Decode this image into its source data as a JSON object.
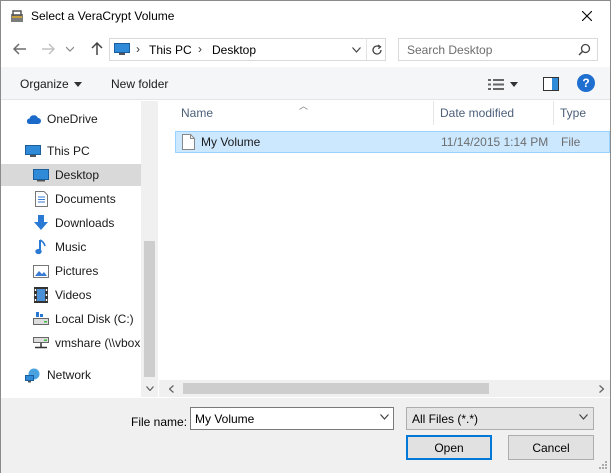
{
  "window": {
    "title": "Select a VeraCrypt Volume"
  },
  "address": {
    "crumbs": [
      "This PC",
      "Desktop"
    ],
    "search_placeholder": "Search Desktop"
  },
  "toolbar": {
    "organize_label": "Organize",
    "new_folder_label": "New folder",
    "help_label": "?"
  },
  "nav": {
    "items": [
      {
        "label": "OneDrive",
        "icon": "cloud-icon"
      },
      {
        "label": "This PC",
        "icon": "computer-icon"
      },
      {
        "label": "Desktop",
        "icon": "desktop-icon"
      },
      {
        "label": "Documents",
        "icon": "documents-icon"
      },
      {
        "label": "Downloads",
        "icon": "downloads-icon"
      },
      {
        "label": "Music",
        "icon": "music-icon"
      },
      {
        "label": "Pictures",
        "icon": "pictures-icon"
      },
      {
        "label": "Videos",
        "icon": "videos-icon"
      },
      {
        "label": "Local Disk (C:)",
        "icon": "local-disk-icon"
      },
      {
        "label": "vmshare (\\\\vbox",
        "icon": "network-drive-icon"
      },
      {
        "label": "Network",
        "icon": "network-icon"
      }
    ]
  },
  "columns": {
    "name": "Name",
    "date": "Date modified",
    "type": "Type"
  },
  "files": [
    {
      "name": "My Volume",
      "date": "11/14/2015 1:14 PM",
      "type": "File"
    }
  ],
  "footer": {
    "file_name_label": "File name:",
    "file_name_value": "My Volume",
    "filter_value": "All Files (*.*)",
    "open_label": "Open",
    "cancel_label": "Cancel"
  },
  "colors": {
    "selection": "#cce8ff",
    "accent": "#0078d7",
    "help": "#1e6fcf"
  }
}
